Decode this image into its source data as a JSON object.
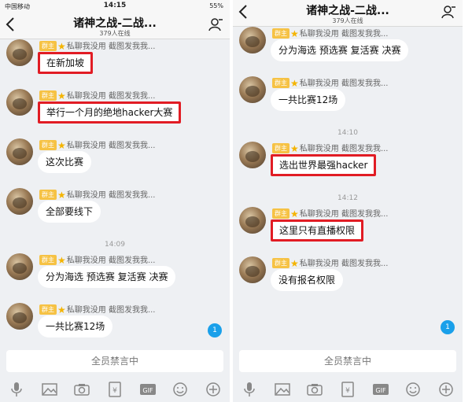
{
  "left": {
    "status": {
      "carrier": "中国移动",
      "time": "14:15",
      "battery": "55%"
    },
    "header": {
      "title": "诸神之战-二战...",
      "online": "379人在线"
    },
    "messages": [
      {
        "kind": "msg",
        "owner": "群主",
        "sender": "私聊我没用 截图发我我...",
        "text": "在新加坡",
        "highlight": true
      },
      {
        "kind": "msg",
        "owner": "群主",
        "sender": "私聊我没用 截图发我我...",
        "text": "举行一个月的绝地hacker大赛",
        "highlight": true
      },
      {
        "kind": "msg",
        "owner": "群主",
        "sender": "私聊我没用 截图发我我...",
        "text": "这次比赛",
        "highlight": false
      },
      {
        "kind": "msg",
        "owner": "群主",
        "sender": "私聊我没用 截图发我我...",
        "text": "全部要线下",
        "highlight": false
      },
      {
        "kind": "time",
        "text": "14:09"
      },
      {
        "kind": "msg",
        "owner": "群主",
        "sender": "私聊我没用 截图发我我...",
        "text": "分为海选 预选赛 复活赛 决赛",
        "highlight": false
      },
      {
        "kind": "msg",
        "owner": "群主",
        "sender": "私聊我没用 截图发我我...",
        "text": "一共比赛12场",
        "highlight": false
      }
    ],
    "badge": "1",
    "mute": "全员禁言中"
  },
  "right": {
    "header": {
      "title": "诸神之战-二战...",
      "online": "379人在线"
    },
    "messages": [
      {
        "kind": "msg",
        "owner": "群主",
        "sender": "私聊我没用 截图发我我...",
        "text": "分为海选 预选赛 复活赛 决赛",
        "highlight": false
      },
      {
        "kind": "msg",
        "owner": "群主",
        "sender": "私聊我没用 截图发我我...",
        "text": "一共比赛12场",
        "highlight": false
      },
      {
        "kind": "time",
        "text": "14:10"
      },
      {
        "kind": "msg",
        "owner": "群主",
        "sender": "私聊我没用 截图发我我...",
        "text": "选出世界最强hacker",
        "highlight": true
      },
      {
        "kind": "time",
        "text": "14:12"
      },
      {
        "kind": "msg",
        "owner": "群主",
        "sender": "私聊我没用 截图发我我...",
        "text": "这里只有直播权限",
        "highlight": true
      },
      {
        "kind": "msg",
        "owner": "群主",
        "sender": "私聊我没用 截图发我我...",
        "text": "没有报名权限",
        "highlight": false
      }
    ],
    "badge": "1",
    "mute": "全员禁言中"
  },
  "toolbar_icons": [
    "microphone-icon",
    "image-icon",
    "camera-icon",
    "red-packet-icon",
    "gif-icon",
    "emoji-icon",
    "plus-icon"
  ],
  "toolbar_gif": "GIF",
  "colors": {
    "highlight": "#e11c24",
    "owner_badge": "#f6c244",
    "accent": "#1aa0ea"
  }
}
